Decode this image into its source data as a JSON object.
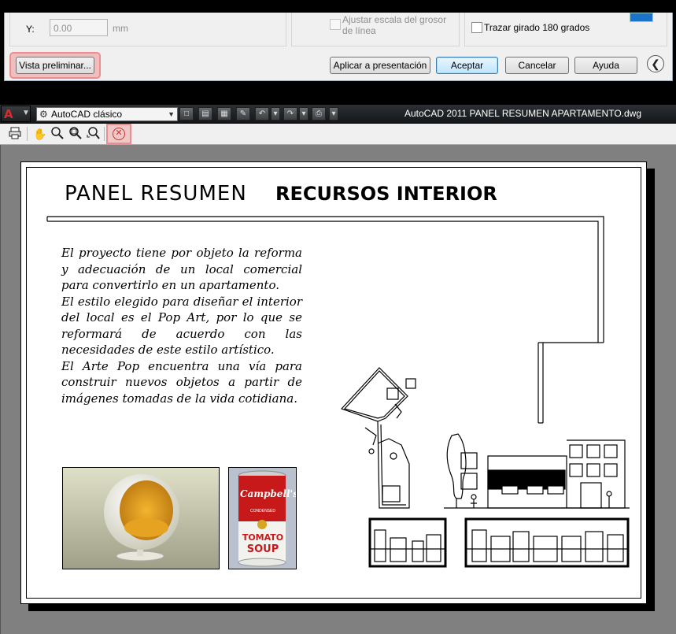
{
  "dialog": {
    "y_label": "Y:",
    "y_value": "0.00",
    "y_unit": "mm",
    "scale_lineweight_label": "Ajustar escala del grosor de línea",
    "plot_upside_down_label": "Trazar girado 180 grados",
    "preview_button": "Vista preliminar...",
    "apply_button": "Aplicar a presentación",
    "ok_button": "Aceptar",
    "cancel_button": "Cancelar",
    "help_button": "Ayuda",
    "more_options_icon": "circle-arrow-left-icon",
    "highlight_color": "#f09696"
  },
  "autocad": {
    "workspace": "AutoCAD clásico",
    "window_title": "AutoCAD 2011    PANEL RESUMEN APARTAMENTO.dwg",
    "app_logo": "autocad-a-icon"
  },
  "preview_toolbar": {
    "icons": [
      "print-icon",
      "pan-hand-icon",
      "zoom-icon",
      "zoom-window-icon",
      "zoom-original-icon",
      "close-preview-icon"
    ]
  },
  "sheet": {
    "title_light": "PANEL  RESUMEN",
    "title_bold": "RECURSOS INTERIOR",
    "paragraphs": [
      "El proyecto tiene por objeto la reforma y adecuación de un local comercial para convertirlo en un apartamento.",
      "El estilo elegido para diseñar el interior del local es el Pop Art, por lo que se reformará de acuerdo con las necesidades de este estilo artístico.",
      "El Arte Pop encuentra una vía para construir nuevos objetos a partir de imágenes tomadas de la vida cotidiana."
    ],
    "soup_can": {
      "brand": "Campbell's",
      "line2": "CONDENSED",
      "flavor1": "TOMATO",
      "flavor2": "SOUP"
    }
  }
}
